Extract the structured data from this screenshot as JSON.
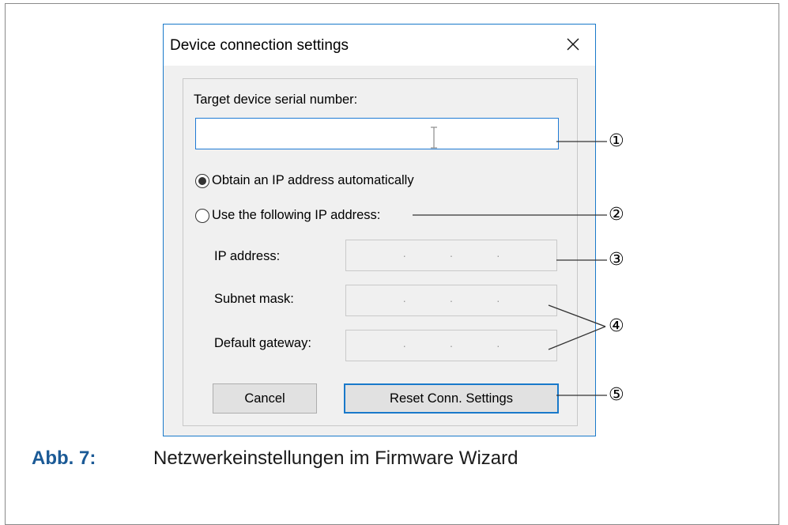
{
  "dialog": {
    "title": "Device connection settings",
    "close_icon": "close-icon",
    "serial_label": "Target device serial number:",
    "serial_value": "",
    "radio_auto": {
      "label": "Obtain an IP address automatically",
      "checked": true
    },
    "radio_manual": {
      "label": "Use the following IP address:",
      "checked": false
    },
    "fields": [
      {
        "label": "IP address:"
      },
      {
        "label": "Subnet mask:"
      },
      {
        "label": "Default gateway:"
      }
    ],
    "buttons": {
      "cancel": "Cancel",
      "reset": "Reset Conn. Settings"
    },
    "colors": {
      "accent": "#1979ca",
      "dialog_bg": "#f0f0f0"
    }
  },
  "callouts": [
    "①",
    "②",
    "③",
    "④",
    "⑤"
  ],
  "caption": {
    "prefix": "Abb. 7:",
    "text": "Netzwerkeinstellungen im Firmware Wizard",
    "prefix_color": "#1b5a96"
  }
}
